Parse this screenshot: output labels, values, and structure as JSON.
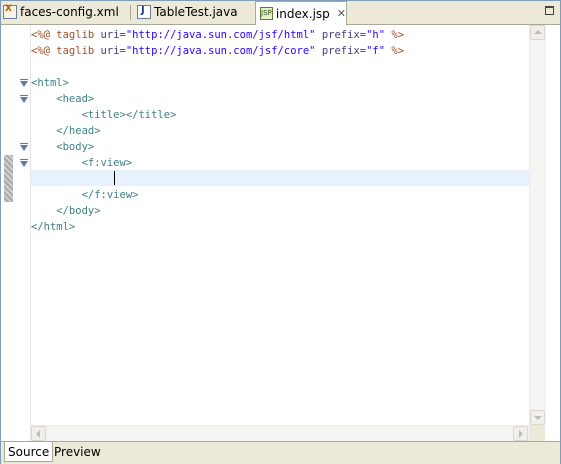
{
  "editor_tabs": [
    {
      "label": "faces-config.xml",
      "icon": "xml-file-icon",
      "active": false
    },
    {
      "label": "TableTest.java",
      "icon": "java-file-icon",
      "active": false
    },
    {
      "label": "index.jsp",
      "icon": "jsp-file-icon",
      "active": true
    }
  ],
  "code_lines": [
    [
      {
        "t": "<%@ taglib ",
        "c": "dir"
      },
      {
        "t": "uri=",
        "c": "kw"
      },
      {
        "t": "\"http://java.sun.com/jsf/html\"",
        "c": "str"
      },
      {
        "t": " ",
        "c": "dir"
      },
      {
        "t": "prefix=",
        "c": "kw"
      },
      {
        "t": "\"h\"",
        "c": "str"
      },
      {
        "t": " %>",
        "c": "dir"
      }
    ],
    [
      {
        "t": "<%@ taglib ",
        "c": "dir"
      },
      {
        "t": "uri=",
        "c": "kw"
      },
      {
        "t": "\"http://java.sun.com/jsf/core\"",
        "c": "str"
      },
      {
        "t": " ",
        "c": "dir"
      },
      {
        "t": "prefix=",
        "c": "kw"
      },
      {
        "t": "\"f\"",
        "c": "str"
      },
      {
        "t": " %>",
        "c": "dir"
      }
    ],
    [],
    [
      {
        "t": "<html>",
        "c": "tag"
      }
    ],
    [
      {
        "t": "    <head>",
        "c": "tag"
      }
    ],
    [
      {
        "t": "        <title></title>",
        "c": "tag"
      }
    ],
    [
      {
        "t": "    </head>",
        "c": "tag"
      }
    ],
    [
      {
        "t": "    <body>",
        "c": "tag"
      }
    ],
    [
      {
        "t": "        <f:view>",
        "c": "tag"
      }
    ],
    [
      {
        "t": "            ",
        "c": "tag"
      }
    ],
    [
      {
        "t": "        </f:view>",
        "c": "tag"
      }
    ],
    [
      {
        "t": "    </body>",
        "c": "tag"
      }
    ],
    [
      {
        "t": "</html>",
        "c": "tag"
      }
    ]
  ],
  "fold_lines": [
    3,
    4,
    7,
    8
  ],
  "bottom_tabs": [
    {
      "label": "Source",
      "active": true
    },
    {
      "label": "Preview",
      "active": false
    }
  ],
  "colors": {
    "directive": "#a0522d",
    "attribute": "#3f3f7f",
    "string": "#2a00ff",
    "tag": "#3f7f7f",
    "current_line": "#e8f2fe"
  }
}
